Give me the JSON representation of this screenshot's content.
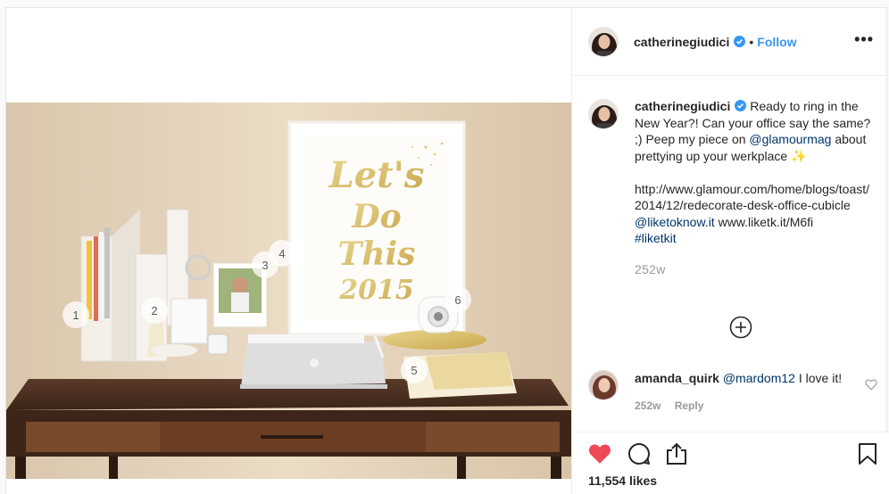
{
  "post": {
    "photo_description": "",
    "username": "catherinegiudici",
    "verified": true,
    "dot": "•",
    "follow_label": "Follow",
    "more_label": "•••",
    "caption": {
      "username": "catherinegiudici",
      "text_1": "Ready to ring in the New Year?! Can your office say the same? ;) Peep my piece on ",
      "mention_1": "@glamourmag",
      "text_2": " about prettying up your werkplace ",
      "sparkle": "✨",
      "url": "http://www.glamour.com/home/blogs/toast/2014/12/redecorate-desk-office-cubicle",
      "mention_2": "@liketoknow.it",
      "text_3": " www.liketk.it/M6fi",
      "hashtag": "#liketkit",
      "age": "252w"
    },
    "comment": {
      "username": "amanda_quirk",
      "mention": "@mardom12",
      "text": " I love it!",
      "age": "252w",
      "reply_label": "Reply"
    },
    "likes": "11,554 likes",
    "colors": {
      "accent": "#3897f0",
      "like": "#ed4956",
      "link": "#003569"
    },
    "photo_labels": [
      "1",
      "2",
      "3",
      "4",
      "5",
      "6"
    ],
    "print_text": [
      "Let's",
      "Do",
      "This",
      "2015"
    ]
  }
}
